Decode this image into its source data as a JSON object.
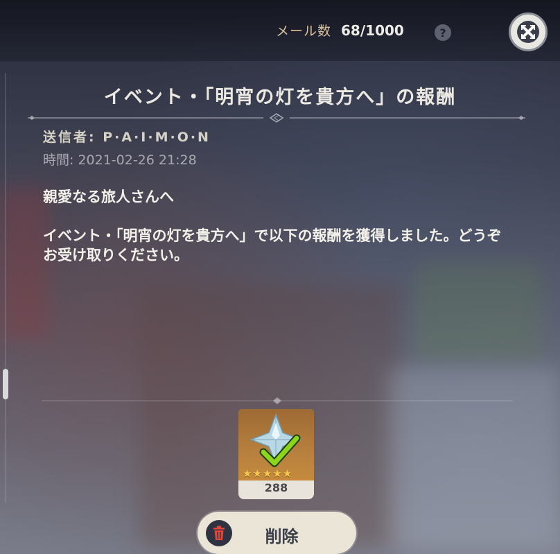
{
  "header": {
    "mail_label": "メール数",
    "mail_count": "68/1000",
    "help_glyph": "?"
  },
  "mail": {
    "title": "イベント・「明宵の灯を貴方へ」の報酬",
    "sender": "送信者: P·A·I·M·O·N",
    "time": "時間: 2021-02-26 21:28",
    "body_line1": "親愛なる旅人さんへ",
    "body_line2": "イベント・「明宵の灯を貴方へ」で以下の報酬を獲得しました。どうぞお受け取りください。"
  },
  "reward": {
    "count": "288",
    "stars": "★★★★★",
    "claimed": true,
    "icon": "primogem-icon"
  },
  "actions": {
    "delete_label": "削除"
  },
  "colors": {
    "accent_gold": "#d8c19a",
    "delete_icon": "#e0463a",
    "claimed_check": "#8ed41a"
  }
}
